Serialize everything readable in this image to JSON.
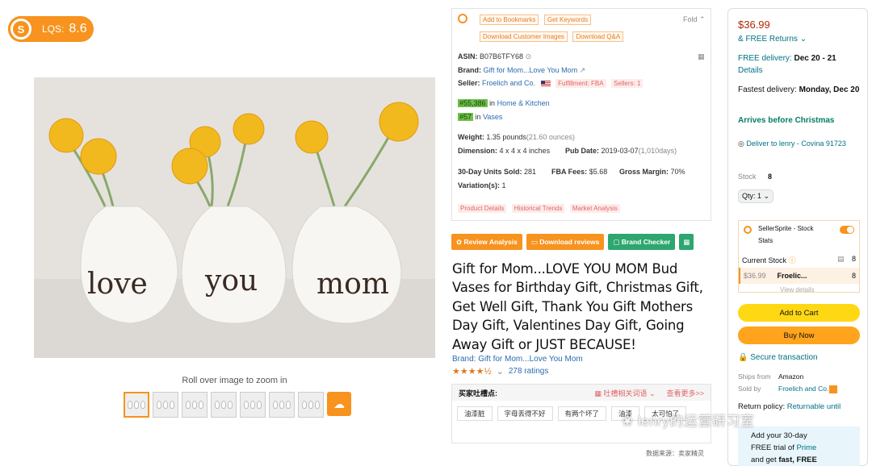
{
  "lqs": {
    "label": "LQS:",
    "value": "8.6",
    "logo": "S"
  },
  "gallery": {
    "words": [
      "love",
      "you",
      "mom"
    ],
    "zoom_hint": "Roll over image to zoom in",
    "thumb_count": 7,
    "upload_icon": "cloud-upload-icon"
  },
  "panel": {
    "tools": [
      "Add to Bookmarks",
      "Get Keywords",
      "Download Customer Images",
      "Download Q&A"
    ],
    "fold": "Fold",
    "asin_label": "ASIN:",
    "asin": "B07B6TFY68",
    "brand_label": "Brand:",
    "brand": "Gift for Mom...Love You Mom",
    "seller_label": "Seller:",
    "seller": "Froelich and Co.",
    "fulfillment": "Fulfillment: FBA",
    "sellers": "Sellers: 1",
    "rank1": "#55,386",
    "rank1_in": "in",
    "rank1_cat": "Home & Kitchen",
    "rank2": "#57",
    "rank2_in": "in",
    "rank2_cat": "Vases",
    "weight_label": "Weight:",
    "weight": "1.35 pounds",
    "weight_oz": "(21.60 ounces)",
    "dim_label": "Dimension:",
    "dim": "4 x 4 x 4 inches",
    "pub_label": "Pub Date:",
    "pub": "2019-03-07",
    "pub_days": "(1,010days)",
    "units_label": "30-Day Units Sold:",
    "units": "281",
    "fba_label": "FBA Fees:",
    "fba": "$5.68",
    "margin_label": "Gross Margin:",
    "margin": "70%",
    "var_label": "Variation(s):",
    "var": "1",
    "lower_tabs": [
      "Product Details",
      "Historical Trends",
      "Market Analysis"
    ]
  },
  "buttons": {
    "review": "Review Analysis",
    "download": "Download reviews",
    "brand": "Brand Checker"
  },
  "title": "Gift for Mom...LOVE YOU MOM Bud Vases for Birthday Gift, Christmas Gift, Get Well Gift, Thank You Gift Mothers Day Gift, Valentines Day Gift, Going Away Gift or JUST BECAUSE!",
  "brand_line": "Brand: Gift for Mom...Love You Mom",
  "rating": {
    "stars": "★★★★½",
    "count": "278 ratings",
    "value": 4.5
  },
  "keywords": {
    "title": "买家吐槽点:",
    "dropdown": "吐槽相关词语",
    "more": "查看更多>>",
    "chips": [
      "油漆脏",
      "字母丢得不好",
      "有两个坏了",
      "油漆",
      "太可怕了"
    ]
  },
  "source": "数据来源：卖家精灵",
  "buybox": {
    "price": "$36.99",
    "returns": "& FREE Returns",
    "delivery_label": "FREE delivery:",
    "delivery_date": "Dec 20 - 21",
    "details": "Details",
    "fastest_label": "Fastest delivery:",
    "fastest_date": "Monday, Dec 20",
    "christmas": "Arrives before Christmas",
    "deliver_to": "Deliver to lenry - Covina 91723",
    "stock_label": "Stock",
    "stock_val": "8",
    "qty": "Qty: 1",
    "ss_label": "SellerSprite - Stock Stats",
    "current_stock": "Current Stock",
    "current_val": "8",
    "row_price": "$36.99",
    "row_seller": "Froelic...",
    "row_stock": "8",
    "view_details": "View details",
    "add_to_cart": "Add to Cart",
    "buy_now": "Buy Now",
    "secure": "Secure transaction",
    "ships_from_label": "Ships from",
    "ships_from": "Amazon",
    "sold_by_label": "Sold by",
    "sold_by": "Froelich and Co.",
    "return_policy_label": "Return policy:",
    "return_policy": "Returnable until",
    "prime_l1": "Add your 30-day",
    "prime_l2a": "FREE trial of ",
    "prime_l2b": "Prime",
    "prime_l3a": "and get ",
    "prime_l3b": "fast, FREE"
  },
  "watermark": "lenry的运营研习室",
  "colors": {
    "accent": "#f7931e",
    "link": "#2b6cb0",
    "price": "#b12704",
    "cart": "#ffd814",
    "buy": "#ffa41c"
  }
}
